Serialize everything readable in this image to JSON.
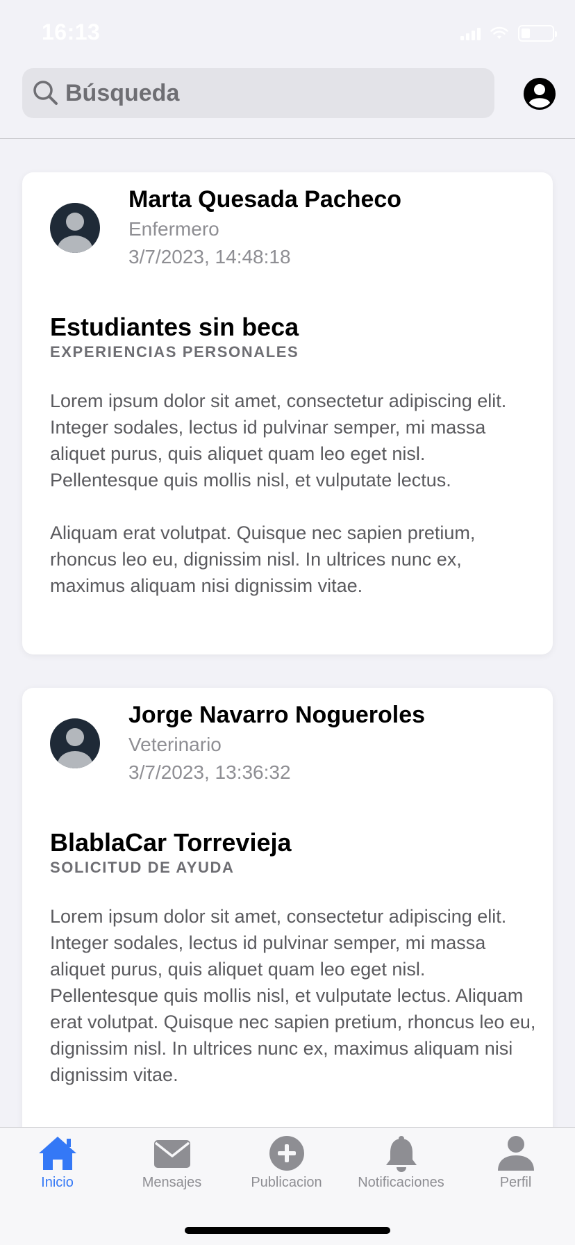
{
  "status_bar": {
    "time": "16:13"
  },
  "search": {
    "placeholder": "Búsqueda"
  },
  "posts": [
    {
      "author": "Marta Quesada Pacheco",
      "role": "Enfermero",
      "date": "3/7/2023, 14:48:18",
      "title": "Estudiantes sin beca",
      "category": "EXPERIENCIAS PERSONALES",
      "paragraphs": [
        "Lorem ipsum dolor sit amet, consectetur adipiscing elit. Integer sodales, lectus id pulvinar semper, mi massa aliquet purus, quis aliquet quam leo eget nisl. Pellentesque quis mollis nisl, et vulputate lectus.",
        "Aliquam erat volutpat. Quisque nec sapien pretium, rhoncus leo eu, dignissim nisl. In ultrices nunc ex, maximus aliquam nisi dignissim vitae."
      ]
    },
    {
      "author": "Jorge Navarro Nogueroles",
      "role": "Veterinario",
      "date": "3/7/2023, 13:36:32",
      "title": "BlablaCar Torrevieja",
      "category": "SOLICITUD DE AYUDA",
      "paragraphs": [
        "Lorem ipsum dolor sit amet, consectetur adipiscing elit. Integer sodales, lectus id pulvinar semper, mi massa aliquet purus, quis aliquet quam leo eget nisl. Pellentesque quis mollis nisl, et vulputate lectus. Aliquam erat volutpat. Quisque nec sapien pretium, rhoncus leo eu, dignissim nisl. In ultrices nunc ex, maximus aliquam nisi dignissim vitae."
      ]
    }
  ],
  "tabbar": {
    "tabs": [
      {
        "label": "Inicio",
        "icon": "home-icon",
        "active": true
      },
      {
        "label": "Mensajes",
        "icon": "envelope-icon",
        "active": false
      },
      {
        "label": "Publicacion",
        "icon": "plus-circle-icon",
        "active": false
      },
      {
        "label": "Notificaciones",
        "icon": "bell-icon",
        "active": false
      },
      {
        "label": "Perfil",
        "icon": "person-icon",
        "active": false
      }
    ]
  },
  "colors": {
    "accent": "#3478f6",
    "inactive": "#8e8e93",
    "background": "#f2f2f7",
    "avatar_dark": "#1f2a37",
    "avatar_light": "#b3b7bc"
  }
}
